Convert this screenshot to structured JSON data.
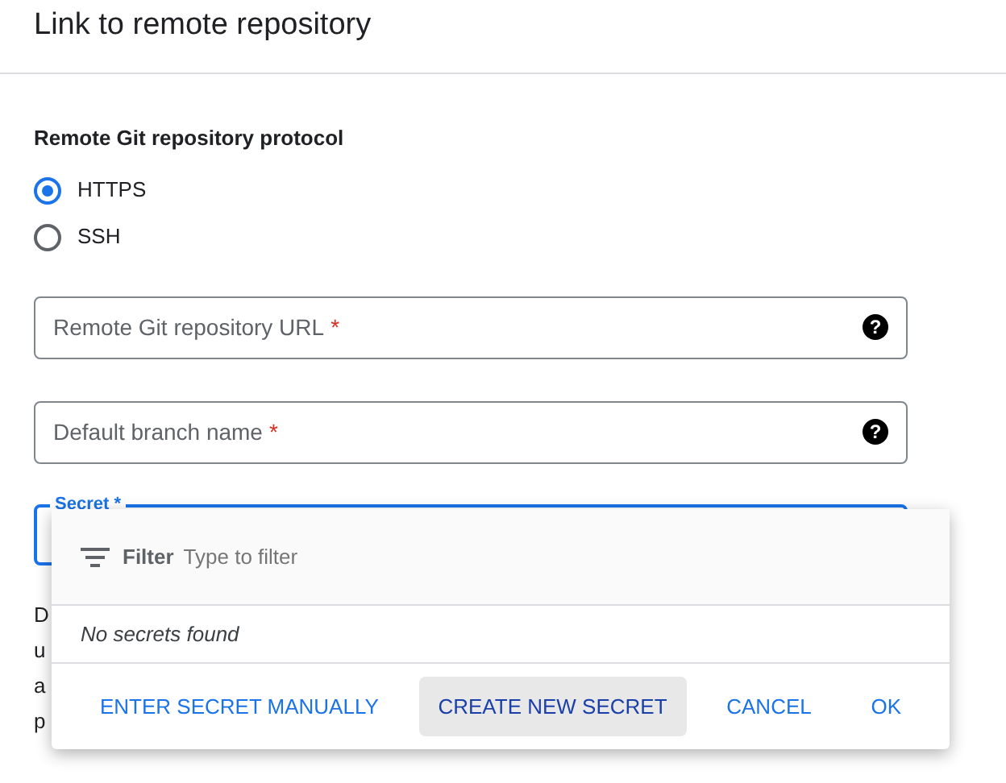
{
  "title": "Link to remote repository",
  "protocol": {
    "label": "Remote Git repository protocol",
    "options": [
      {
        "label": "HTTPS",
        "selected": true
      },
      {
        "label": "SSH",
        "selected": false
      }
    ]
  },
  "fields": [
    {
      "placeholder": "Remote Git repository URL",
      "required_mark": "*",
      "help_icon": "?"
    },
    {
      "placeholder": "Default branch name",
      "required_mark": "*",
      "help_icon": "?"
    }
  ],
  "secret": {
    "label": "Secret *",
    "focused": true
  },
  "hidden_text": [
    "D",
    "u",
    "a",
    "p"
  ],
  "popup": {
    "filter_label": "Filter",
    "filter_placeholder": "Type to filter",
    "empty": "No secrets found",
    "buttons": [
      {
        "label": "ENTER SECRET MANUALLY",
        "highlighted": false
      },
      {
        "label": "CREATE NEW SECRET",
        "highlighted": true
      },
      {
        "label": "CANCEL",
        "highlighted": false
      },
      {
        "label": "OK",
        "highlighted": false
      }
    ]
  }
}
